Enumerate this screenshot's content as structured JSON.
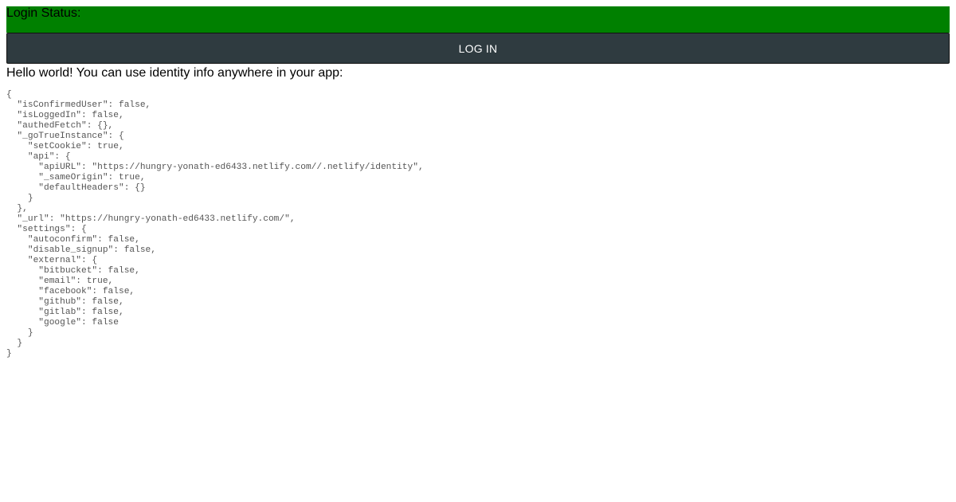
{
  "status": {
    "label": "Login Status:",
    "color": "#008000"
  },
  "login_button": {
    "label": "LOG IN"
  },
  "hello_text": "Hello world! You can use identity info anywhere in your app:",
  "identity_json": "{\n  \"isConfirmedUser\": false,\n  \"isLoggedIn\": false,\n  \"authedFetch\": {},\n  \"_goTrueInstance\": {\n    \"setCookie\": true,\n    \"api\": {\n      \"apiURL\": \"https://hungry-yonath-ed6433.netlify.com//.netlify/identity\",\n      \"_sameOrigin\": true,\n      \"defaultHeaders\": {}\n    }\n  },\n  \"_url\": \"https://hungry-yonath-ed6433.netlify.com/\",\n  \"settings\": {\n    \"autoconfirm\": false,\n    \"disable_signup\": false,\n    \"external\": {\n      \"bitbucket\": false,\n      \"email\": true,\n      \"facebook\": false,\n      \"github\": false,\n      \"gitlab\": false,\n      \"google\": false\n    }\n  }\n}"
}
